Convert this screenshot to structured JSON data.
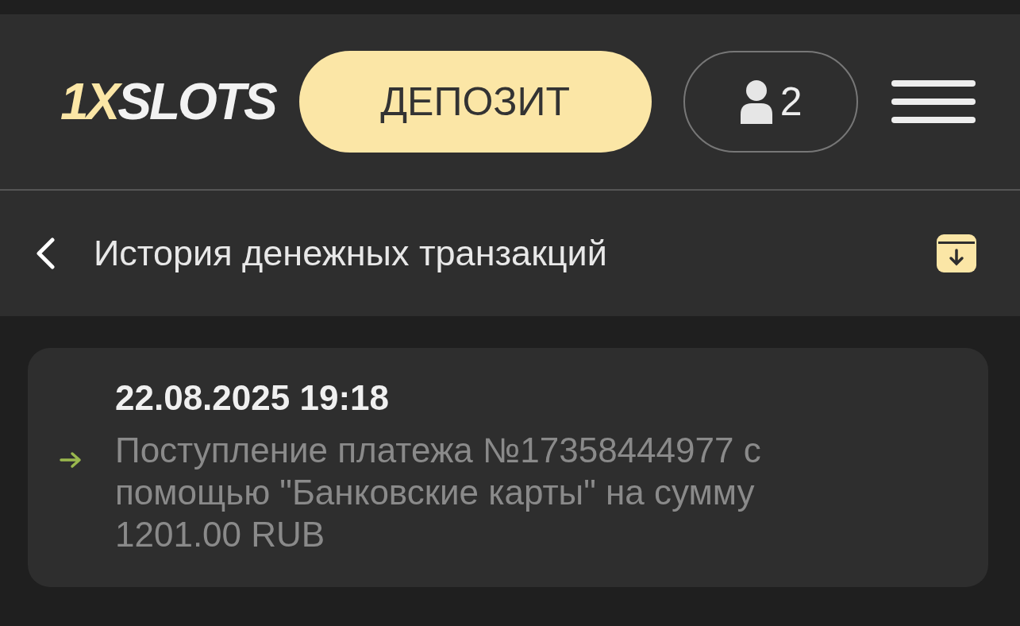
{
  "header": {
    "logo": {
      "accent": "1X",
      "rest": "SLOTS"
    },
    "deposit_button": "ДЕПОЗИТ",
    "profile_button": {
      "count": "2"
    }
  },
  "page": {
    "title": "История денежных транзакций"
  },
  "transactions": [
    {
      "date": "22.08.2025 19:18",
      "incoming": true,
      "description": "Поступление платежа №17358444977 с помощью \"Банковские карты\" на сумму 1201.00 RUB"
    }
  ]
}
